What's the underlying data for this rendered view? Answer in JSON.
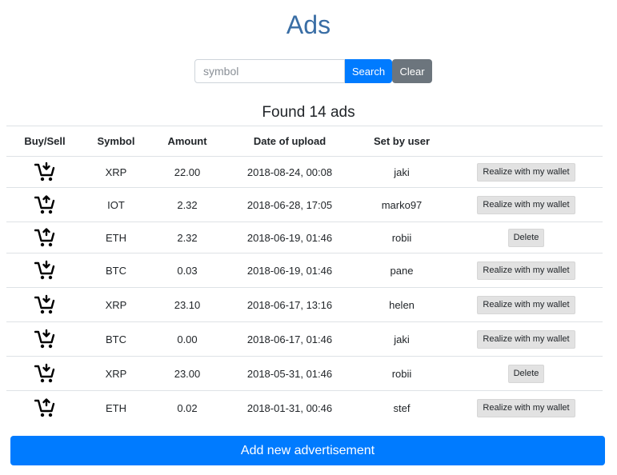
{
  "page": {
    "title": "Ads"
  },
  "search": {
    "placeholder": "symbol",
    "value": "",
    "search_label": "Search",
    "clear_label": "Clear"
  },
  "results": {
    "found_text": "Found 14 ads"
  },
  "table": {
    "headers": [
      "Buy/Sell",
      "Symbol",
      "Amount",
      "Date of upload",
      "Set by user",
      ""
    ],
    "rows": [
      {
        "type": "buy",
        "symbol": "XRP",
        "amount": "22.00",
        "date": "2018-08-24, 00:08",
        "user": "jaki",
        "action": "Realize with my wallet"
      },
      {
        "type": "sell",
        "symbol": "IOT",
        "amount": "2.32",
        "date": "2018-06-28, 17:05",
        "user": "marko97",
        "action": "Realize with my wallet"
      },
      {
        "type": "sell",
        "symbol": "ETH",
        "amount": "2.32",
        "date": "2018-06-19, 01:46",
        "user": "robii",
        "action": "Delete"
      },
      {
        "type": "buy",
        "symbol": "BTC",
        "amount": "0.03",
        "date": "2018-06-19, 01:46",
        "user": "pane",
        "action": "Realize with my wallet"
      },
      {
        "type": "buy",
        "symbol": "XRP",
        "amount": "23.10",
        "date": "2018-06-17, 13:16",
        "user": "helen",
        "action": "Realize with my wallet"
      },
      {
        "type": "buy",
        "symbol": "BTC",
        "amount": "0.00",
        "date": "2018-06-17, 01:46",
        "user": "jaki",
        "action": "Realize with my wallet"
      },
      {
        "type": "buy",
        "symbol": "XRP",
        "amount": "23.00",
        "date": "2018-05-31, 01:46",
        "user": "robii",
        "action": "Delete"
      },
      {
        "type": "sell",
        "symbol": "ETH",
        "amount": "0.02",
        "date": "2018-01-31, 00:46",
        "user": "stef",
        "action": "Realize with my wallet"
      }
    ]
  },
  "footer": {
    "add_label": "Add new advertisement"
  },
  "icons": {
    "buy": "cart-arrow-down-icon",
    "sell": "cart-arrow-up-icon"
  },
  "colors": {
    "title": "#3a6ea5",
    "primary": "#007bff",
    "secondary": "#6c757d",
    "action_bg": "#e2e2e2"
  }
}
